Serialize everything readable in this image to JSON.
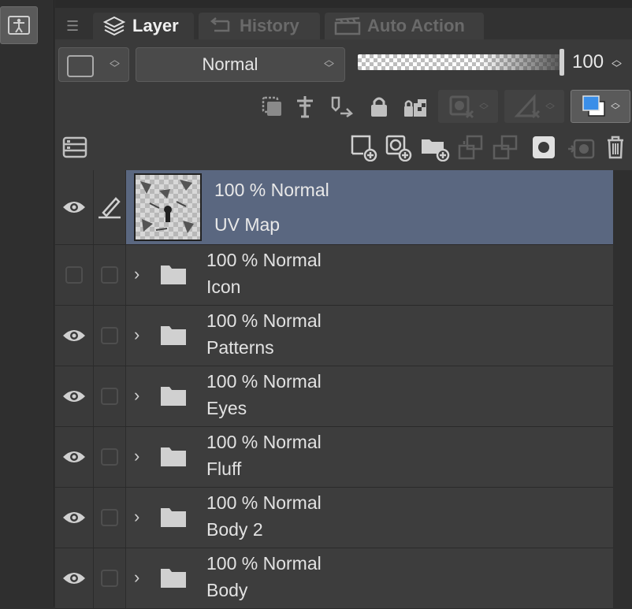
{
  "panel_tabs": [
    {
      "label": "Layer",
      "icon": "layers-icon",
      "active": true
    },
    {
      "label": "History",
      "icon": "history-icon",
      "active": false
    },
    {
      "label": "Auto Action",
      "icon": "clapperboard-icon",
      "active": false
    }
  ],
  "blend_mode": "Normal",
  "opacity_value": "100",
  "colors": {
    "selection": "#5a6780",
    "panel": "#3a3a3a",
    "accent_blue": "#3a8ee8"
  },
  "layers": [
    {
      "opacity_mode": "100 % Normal",
      "name": "UV Map",
      "selected": true,
      "visible": true,
      "editing": true,
      "type": "raster"
    },
    {
      "opacity_mode": "100 % Normal",
      "name": "Icon",
      "selected": false,
      "visible": false,
      "type": "folder"
    },
    {
      "opacity_mode": "100 % Normal",
      "name": "Patterns",
      "selected": false,
      "visible": true,
      "type": "folder"
    },
    {
      "opacity_mode": "100 % Normal",
      "name": "Eyes",
      "selected": false,
      "visible": true,
      "type": "folder"
    },
    {
      "opacity_mode": "100 % Normal",
      "name": "Fluff",
      "selected": false,
      "visible": true,
      "type": "folder"
    },
    {
      "opacity_mode": "100 % Normal",
      "name": "Body 2",
      "selected": false,
      "visible": true,
      "type": "folder"
    },
    {
      "opacity_mode": "100 % Normal",
      "name": "Body",
      "selected": false,
      "visible": true,
      "type": "folder"
    }
  ]
}
